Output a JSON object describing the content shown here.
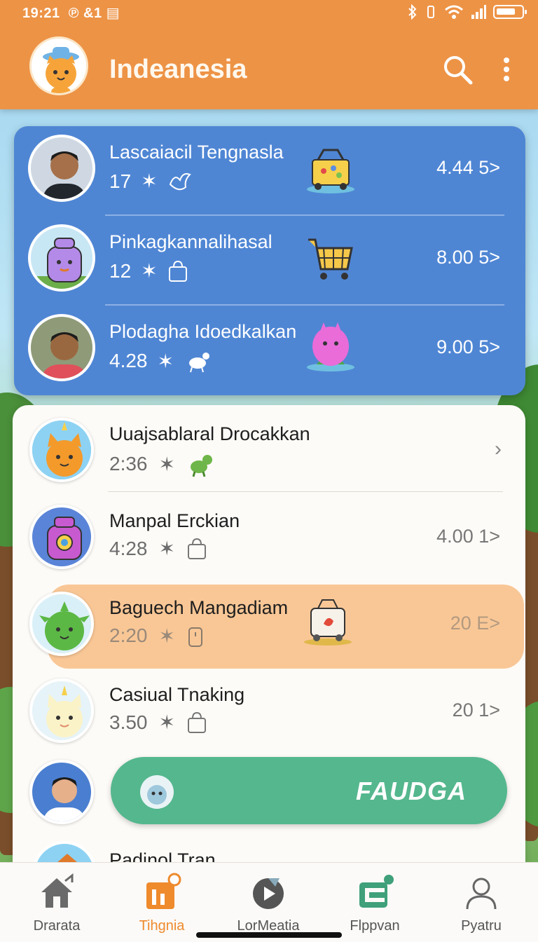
{
  "status_bar": {
    "time": "19:21",
    "extra": "℗ &1 ▤"
  },
  "header": {
    "title": "Indeanesia"
  },
  "featured": [
    {
      "name": "Lascaiacil Tengnasla",
      "count": "17",
      "value": "4.44 5>"
    },
    {
      "name": "Pinkagkannalihasal",
      "count": "12",
      "value": "8.00 5>"
    },
    {
      "name": "Plodagha Idoedkalkan",
      "count": "4.28",
      "value": "9.00 5>"
    }
  ],
  "list": [
    {
      "name": "Uuajsablaral Drocakkan",
      "time": "2:36",
      "value": ""
    },
    {
      "name": "Manpal Erckian",
      "time": "4:28",
      "value": "4.00 1>"
    },
    {
      "name": "Baguech Mangadiam",
      "time": "2:20",
      "value": "20 E>"
    },
    {
      "name": "Casiual Tnaking",
      "time": "3.50",
      "value": "20 1>"
    }
  ],
  "cta": {
    "label": "FAUDGA"
  },
  "cut_row": {
    "name": "Padinol Tran"
  },
  "nav": [
    {
      "label": "Drarata",
      "icon": "home-icon"
    },
    {
      "label": "Tihgnia",
      "icon": "chart-icon"
    },
    {
      "label": "LorMeatia",
      "icon": "play-icon"
    },
    {
      "label": "Flppvan",
      "icon": "wallet-icon"
    },
    {
      "label": "Pyatru",
      "icon": "profile-icon"
    }
  ],
  "colors": {
    "header": "#ed9346",
    "featured": "#4f86d4",
    "highlight": "#f9c796",
    "cta": "#55b78e",
    "nav_active": "#ef8a2d"
  }
}
